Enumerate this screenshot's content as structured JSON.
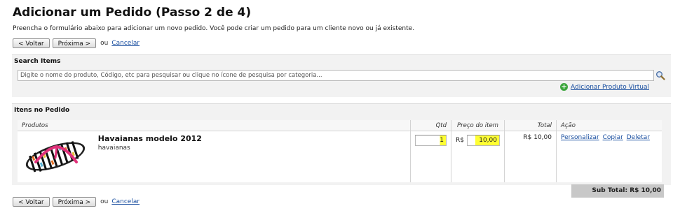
{
  "page": {
    "title": "Adicionar um Pedido (Passo 2 de 4)",
    "description": "Preencha o formulário abaixo para adicionar um novo pedido. Você pode criar um pedido para um cliente novo ou já existente."
  },
  "nav": {
    "back_label": "< Voltar",
    "next_label": "Próxima >",
    "or_text": "ou",
    "cancel_label": "Cancelar"
  },
  "search": {
    "section_title": "Search Items",
    "placeholder": "Digite o nome do produto, Código, etc para pesquisar ou clique no ícone de pesquisa por categoria...",
    "add_virtual_label": "Adicionar Produto Virtual"
  },
  "order_items": {
    "section_title": "Itens no Pedido",
    "columns": {
      "products": "Produtos",
      "qty": "Qtd",
      "price": "Preço do item",
      "total": "Total",
      "action": "Ação"
    },
    "rows": [
      {
        "name": "Havaianas modelo 2012",
        "brand": "havaianas",
        "qty": "1",
        "currency": "R$",
        "price": "10,00",
        "total": "R$ 10,00",
        "actions": [
          "Personalizar",
          "Copiar",
          "Deletar"
        ]
      }
    ],
    "subtotal": "Sub Total: R$ 10,00"
  },
  "colors": {
    "link": "#1a4fa0",
    "highlight": "#ffff33",
    "section_bg": "#f2f2f2"
  }
}
